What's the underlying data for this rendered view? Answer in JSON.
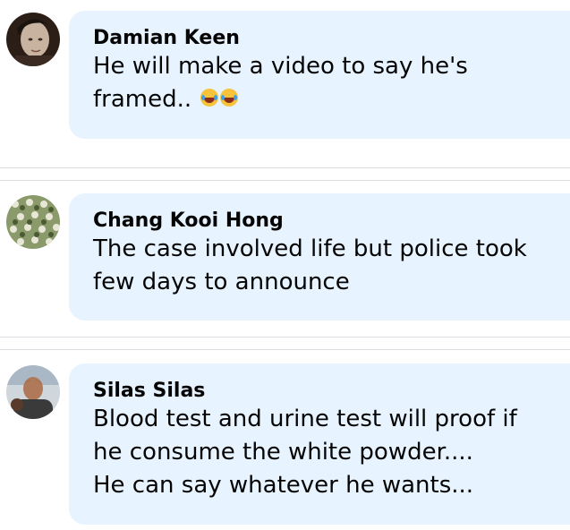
{
  "comments": [
    {
      "author": "Damian Keen",
      "text": "He will make a video to say he's\nframed..",
      "emoji": [
        "laughing-tears-emoji",
        "laughing-tears-emoji"
      ],
      "avatar_icon": "user-avatar-photo"
    },
    {
      "author": "Chang Kooi Hong",
      "text": "The case involved life but police took\nfew days to announce",
      "avatar_icon": "user-avatar-pattern"
    },
    {
      "author": "Silas Silas",
      "text": "Blood test and urine test will proof if\nhe consume the white powder....\nHe can say whatever he wants...",
      "avatar_icon": "user-avatar-photo"
    }
  ],
  "colors": {
    "bubble": "#e7f3ff",
    "divider": "#dadde1",
    "text": "#050505"
  }
}
